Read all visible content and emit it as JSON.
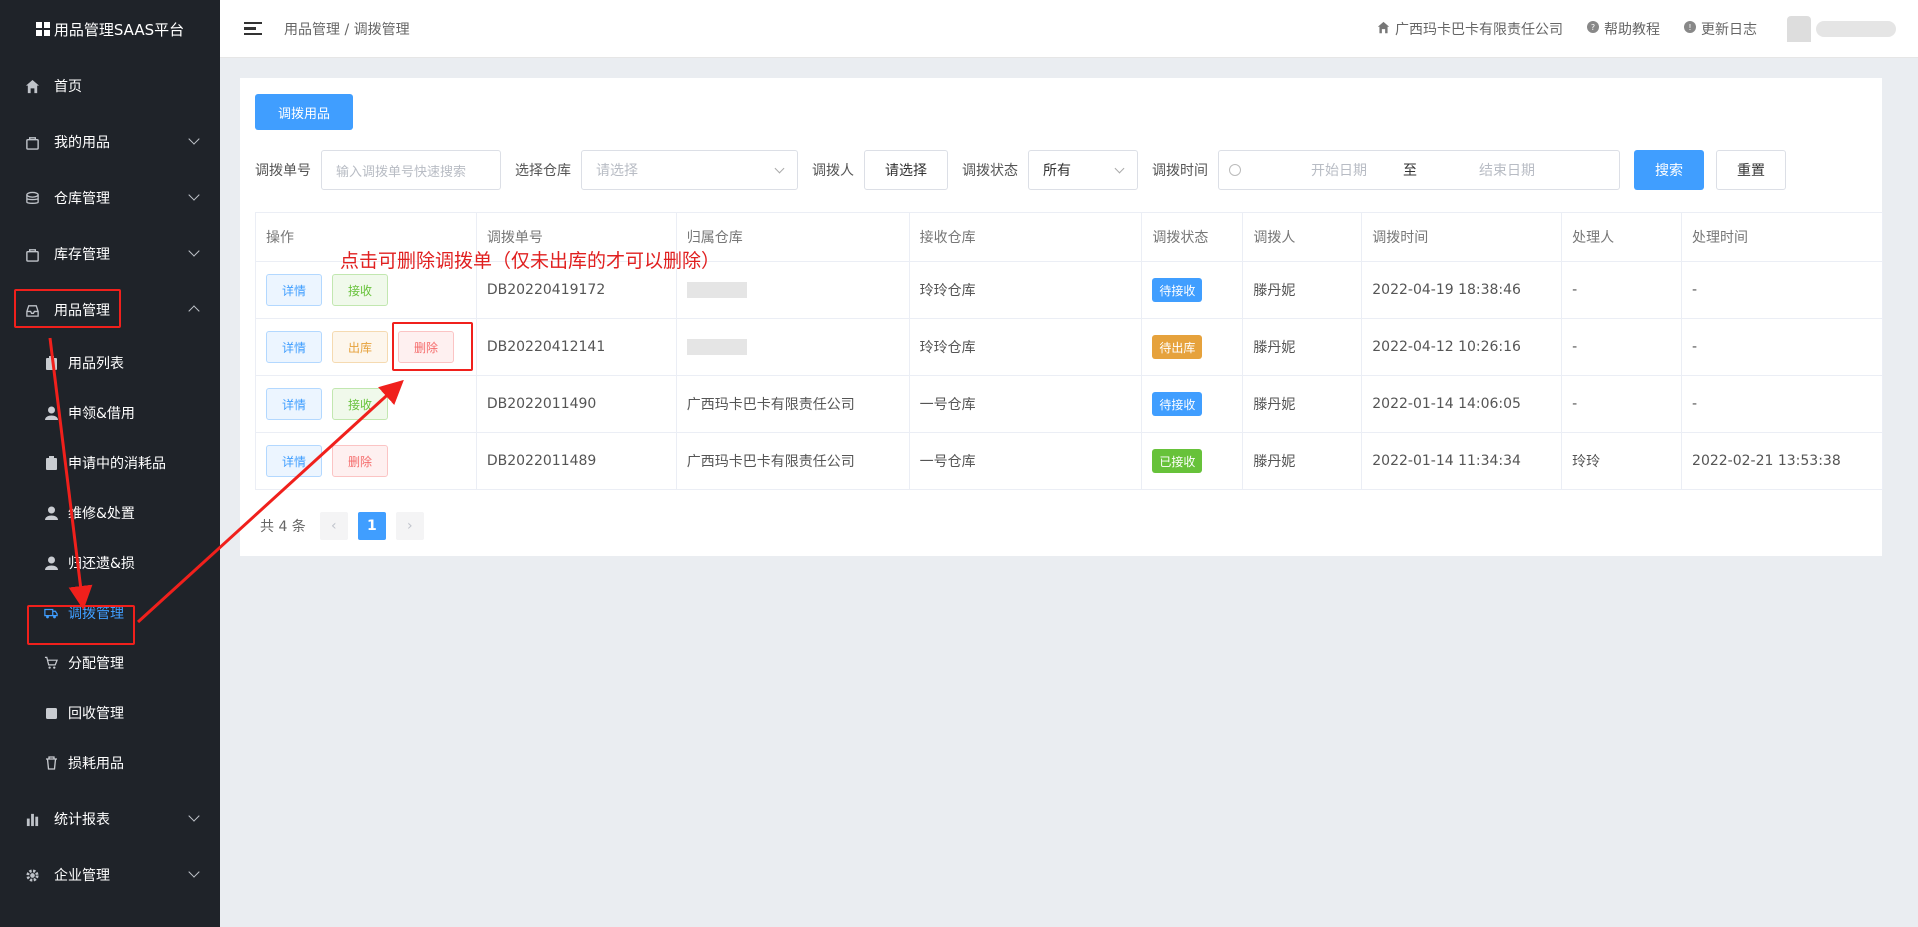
{
  "app": {
    "title": "用品管理SAAS平台"
  },
  "sidebar": {
    "items": [
      {
        "label": "首页",
        "icon": "home-icon"
      },
      {
        "label": "我的用品",
        "icon": "bag-icon"
      },
      {
        "label": "仓库管理",
        "icon": "database-icon"
      },
      {
        "label": "库存管理",
        "icon": "bag-icon"
      },
      {
        "label": "用品管理",
        "icon": "inbox-icon"
      }
    ],
    "sub_items": [
      {
        "label": "用品列表",
        "icon": "clipboard-icon"
      },
      {
        "label": "申领&借用",
        "icon": "user-icon"
      },
      {
        "label": "申请中的消耗品",
        "icon": "clipboard-icon"
      },
      {
        "label": "维修&处置",
        "icon": "user-icon"
      },
      {
        "label": "归还遗&损",
        "icon": "user-icon"
      },
      {
        "label": "调拨管理",
        "icon": "truck-icon"
      },
      {
        "label": "分配管理",
        "icon": "cart-icon"
      },
      {
        "label": "回收管理",
        "icon": "box-icon"
      },
      {
        "label": "损耗用品",
        "icon": "trash-icon"
      }
    ],
    "bottom_items": [
      {
        "label": "统计报表",
        "icon": "bar-chart-icon"
      },
      {
        "label": "企业管理",
        "icon": "gear-icon"
      }
    ]
  },
  "header": {
    "breadcrumb": "用品管理 / 调拨管理",
    "company": "广西玛卡巴卡有限责任公司",
    "help": "帮助教程",
    "changelog": "更新日志"
  },
  "toolbar": {
    "transfer_button": "调拨用品"
  },
  "filters": {
    "order_label": "调拨单号",
    "order_placeholder": "输入调拨单号快速搜索",
    "warehouse_label": "选择仓库",
    "warehouse_placeholder": "请选择",
    "person_label": "调拨人",
    "person_button": "请选择",
    "status_label": "调拨状态",
    "status_value": "所有",
    "time_label": "调拨时间",
    "start_placeholder": "开始日期",
    "range_sep": "至",
    "end_placeholder": "结束日期",
    "search_button": "搜索",
    "reset_button": "重置"
  },
  "table": {
    "headers": [
      "操作",
      "调拨单号",
      "归属仓库",
      "接收仓库",
      "调拨状态",
      "调拨人",
      "调拨时间",
      "处理人",
      "处理时间"
    ],
    "rows": [
      {
        "actions": [
          "详情",
          "接收"
        ],
        "order": "DB20220419172",
        "owner": "",
        "receiver": "玲玲仓库",
        "status": "待接收",
        "status_color": "#409eff",
        "person": "滕丹妮",
        "time": "2022-04-19 18:38:46",
        "handler": "-",
        "handle_time": "-"
      },
      {
        "actions": [
          "详情",
          "出库",
          "删除"
        ],
        "order": "DB20220412141",
        "owner": "",
        "receiver": "玲玲仓库",
        "status": "待出库",
        "status_color": "#e6a23c",
        "person": "滕丹妮",
        "time": "2022-04-12 10:26:16",
        "handler": "-",
        "handle_time": "-"
      },
      {
        "actions": [
          "详情",
          "接收"
        ],
        "order": "DB2022011490",
        "owner": "广西玛卡巴卡有限责任公司",
        "receiver": "一号仓库",
        "status": "待接收",
        "status_color": "#409eff",
        "person": "滕丹妮",
        "time": "2022-01-14 14:06:05",
        "handler": "-",
        "handle_time": "-"
      },
      {
        "actions": [
          "详情",
          "删除"
        ],
        "order": "DB2022011489",
        "owner": "广西玛卡巴卡有限责任公司",
        "receiver": "一号仓库",
        "status": "已接收",
        "status_color": "#67c23a",
        "person": "滕丹妮",
        "time": "2022-01-14 11:34:34",
        "handler": "玲玲",
        "handle_time": "2022-02-21 13:53:38"
      }
    ]
  },
  "pagination": {
    "total": "共 4 条",
    "current": "1"
  },
  "annotation": {
    "text": "点击可删除调拨单（仅未出库的才可以删除）",
    "color": "#e02020"
  }
}
